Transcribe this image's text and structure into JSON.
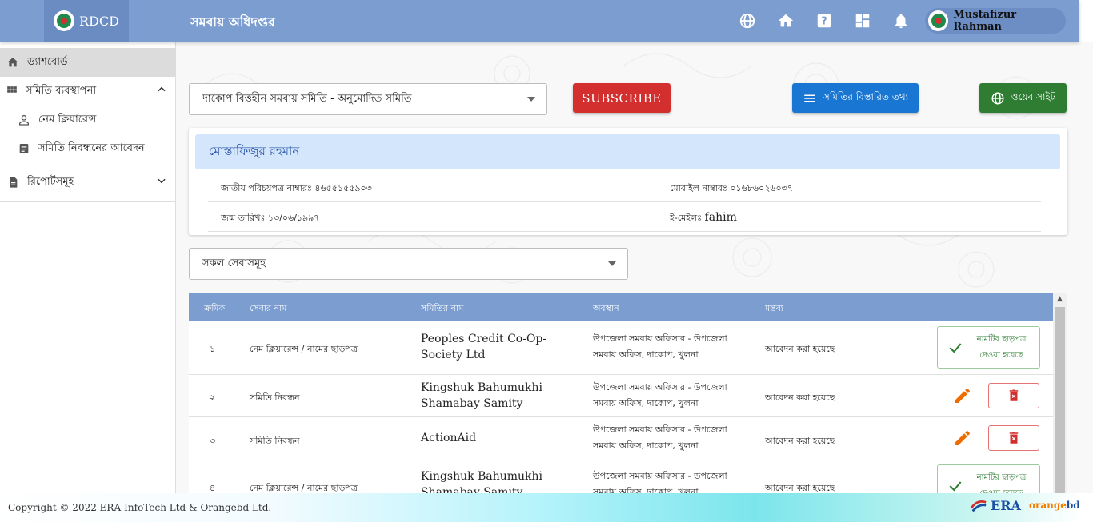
{
  "header": {
    "brand": "RDCD",
    "app_title": "সমবায় অধিদপ্তর",
    "icons": [
      "globe-icon",
      "home-icon",
      "help-icon",
      "dashboard-grid-icon",
      "bell-icon"
    ],
    "user_name": "Mustafizur Rahman"
  },
  "sidebar": {
    "items": [
      {
        "label": "ড্যাশবোর্ড",
        "icon": "dashboard-home-icon"
      },
      {
        "label": "সমিতি ব্যবস্থাপনা",
        "icon": "grid-icon"
      },
      {
        "label": "নেম ক্লিয়ারেন্স",
        "icon": "person-icon"
      },
      {
        "label": "সমিতি নিবন্ধনের আবেদন",
        "icon": "document-icon"
      },
      {
        "label": "রিপোর্টসমূহ",
        "icon": "report-icon"
      }
    ]
  },
  "toolbar": {
    "society_select": "দাকোপ বিত্তহীন সমবায় সমিতি - অনুমোদিত সমিতি",
    "subscribe_label": "SUBSCRIBE",
    "details_label": "সমিতির বিস্তারিত তথ্য",
    "website_label": "ওয়েব সাইট"
  },
  "profile": {
    "name": "মোস্তাফিজুর রহমান",
    "nid": "জাতীয় পরিচয়পত্র নাম্বারঃ ৪৬৫৫১৫৫৯০৩",
    "mobile": "মোবাইল নাম্বারঃ ০১৬৮৬০২৬০৩৭",
    "dob": "জন্ম তারিখঃ ১৩/০৬/১৯৯৭",
    "email_label": "ই-মেইলঃ",
    "email_value": "fahim"
  },
  "filter": {
    "service_select": "সকল সেবাসমূহ"
  },
  "table": {
    "headers": [
      "ক্রমিক",
      "সেবার নাম",
      "সমিতির নাম",
      "অবস্থান",
      "মন্তব্য"
    ],
    "rows": [
      {
        "serial": "১",
        "service": "নেম ক্লিয়ারেন্স / নামের ছাড়পত্র",
        "society": "Peoples Credit Co-Op-Society Ltd",
        "location": "উপজেলা সমবায় অফিসার - উপজেলা সমবায় অফিস, দাকোপ, খুলনা",
        "comment": "আবেদন করা হয়েছে",
        "action": "নামটির ছাড়পত্র দেওয়া হয়েছে"
      },
      {
        "serial": "২",
        "service": "সমিতি নিবন্ধন",
        "society": "Kingshuk Bahumukhi Shamabay Samity",
        "location": "উপজেলা সমবায় অফিসার - উপজেলা সমবায় অফিস, দাকোপ, খুলনা",
        "comment": "আবেদন করা হয়েছে"
      },
      {
        "serial": "৩",
        "service": "সমিতি নিবন্ধন",
        "society": "ActionAid",
        "location": "উপজেলা সমবায় অফিসার - উপজেলা সমবায় অফিস, দাকোপ, খুলনা",
        "comment": "আবেদন করা হয়েছে"
      },
      {
        "serial": "৪",
        "service": "নেম ক্লিয়ারেন্স / নামের ছাড়পত্র",
        "society": "Kingshuk Bahumukhi Shamabay Samity",
        "location": "উপজেলা সমবায় অফিসার - উপজেলা সমবায় অফিস, দাকোপ, খুলনা",
        "comment": "আবেদন করা হয়েছে",
        "action": "নামটির ছাড়পত্র দেওয়া হয়েছে"
      }
    ]
  },
  "footer": {
    "copyright": "Copyright © 2022 ERA-InfoTech Ltd & Orangebd Ltd.",
    "era_logo": "ERA",
    "orange_logo_a": "orange",
    "orange_logo_b": "bd"
  },
  "colors": {
    "header_bg": "#7b9dd0",
    "subscribe": "#d32f2f",
    "details": "#1976d2",
    "website": "#2e7d32",
    "profile_header_bg": "#d3e6fb",
    "edit_icon": "#ef6c00",
    "delete_icon": "#d32f2f"
  }
}
